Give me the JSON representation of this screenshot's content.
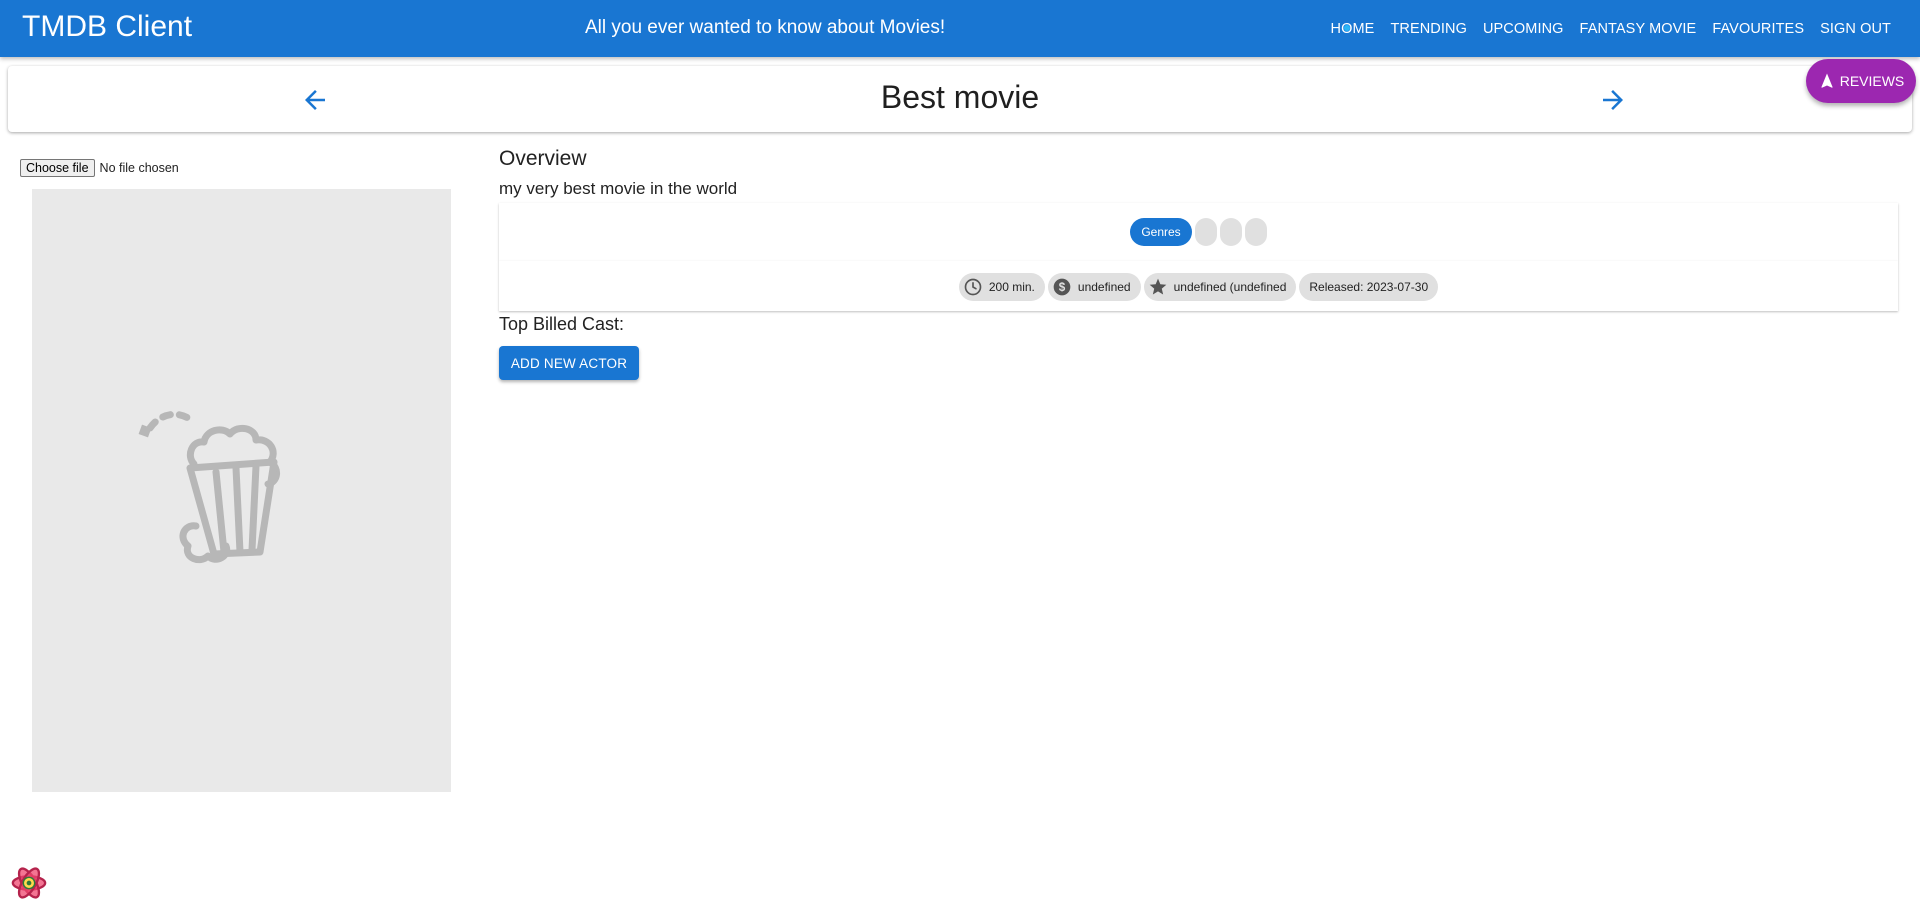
{
  "app": {
    "title": "TMDB Client",
    "tagline": "All you ever wanted to know about Movies!"
  },
  "nav": {
    "items": [
      "HOME",
      "TRENDING",
      "UPCOMING",
      "FANTASY MOVIE",
      "FAVOURITES",
      "SIGN OUT"
    ]
  },
  "header": {
    "title": "Best movie"
  },
  "fab": {
    "label": "REVIEWS"
  },
  "file_input": {
    "button": "Choose file",
    "status": "No file chosen"
  },
  "overview": {
    "heading": "Overview",
    "text": "my very best movie in the world"
  },
  "genres": {
    "label": "Genres"
  },
  "details": {
    "runtime": "200 min.",
    "revenue": "undefined",
    "rating": "undefined (undefined",
    "released": "Released: 2023-07-30"
  },
  "cast": {
    "heading": "Top Billed Cast:",
    "add_button": "ADD NEW ACTOR"
  },
  "colors": {
    "primary": "#1976d2",
    "fab": "#9c27b0",
    "chip": "#e0e0e0",
    "poster_bg": "#e9e9e9"
  },
  "icons": [
    "arrow-back-icon",
    "arrow-forward-icon",
    "navigation-icon",
    "clock-icon",
    "dollar-icon",
    "star-icon",
    "popcorn-icon",
    "react-query-logo"
  ]
}
